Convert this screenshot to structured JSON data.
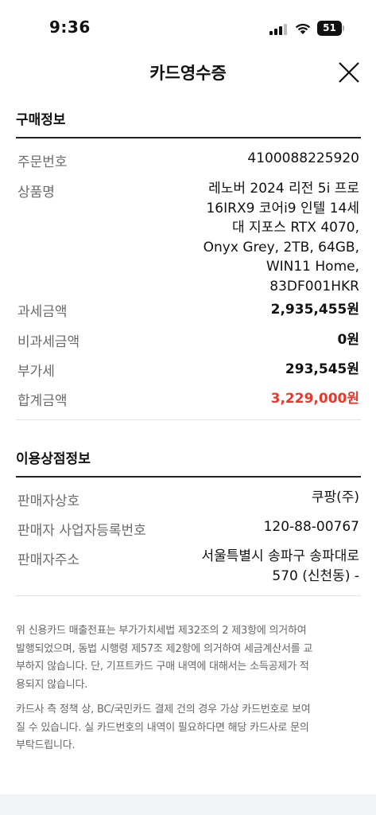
{
  "status_bar": {
    "time": "9:36",
    "battery": "51"
  },
  "header": {
    "title": "카드영수증"
  },
  "purchase_info": {
    "section_title": "구매정보",
    "order_no_label": "주문번호",
    "order_no_value": "4100088225920",
    "product_label": "상품명",
    "product_lines": [
      "레노버 2024 리전 5i 프로",
      "16IRX9 코어i9 인텔 14세",
      "대 지포스 RTX 4070,",
      "Onyx Grey, 2TB, 64GB,",
      "WIN11 Home,",
      "83DF001HKR"
    ],
    "taxable_label": "과세금액",
    "taxable_value": "2,935,455원",
    "non_taxable_label": "비과세금액",
    "non_taxable_value": "0원",
    "vat_label": "부가세",
    "vat_value": "293,545원",
    "total_label": "합계금액",
    "total_value": "3,229,000원"
  },
  "merchant_info": {
    "section_title": "이용상점정보",
    "seller_name_label": "판매자상호",
    "seller_name_value": "쿠팡(주)",
    "reg_no_label": "판매자 사업자등록번호",
    "reg_no_value": "120-88-00767",
    "address_label": "판매자주소",
    "address_lines": [
      "서울특별시 송파구 송파대로",
      "570 (신천동) -"
    ]
  },
  "notices": {
    "notice1_lines": [
      "위 신용카드 매출전표는 부가가치세법 제32조의 2 제3항에 의거하여",
      "발행되었으며, 동법 시행령 제57조 제2항에 의거하여 세금계산서를 교",
      "부하지 않습니다. 단, 기프트카드 구매 내역에 대해서는 소득공제가 적",
      "용되지 않습니다."
    ],
    "notice2_lines": [
      "카드사 측 정책 상, BC/국민카드 결제 건의 경우 가상 카드번호로 보여",
      "질 수 있습니다. 실 카드번호의 내역이 필요하다면 해당 카드사로 문의",
      "부탁드립니다."
    ]
  },
  "icons": {
    "signal": "cellular-signal-icon",
    "wifi": "wifi-icon",
    "battery": "battery-icon",
    "close": "close-icon"
  },
  "colors": {
    "total_red": "#e8382c",
    "label_gray": "#6b6b6b"
  }
}
